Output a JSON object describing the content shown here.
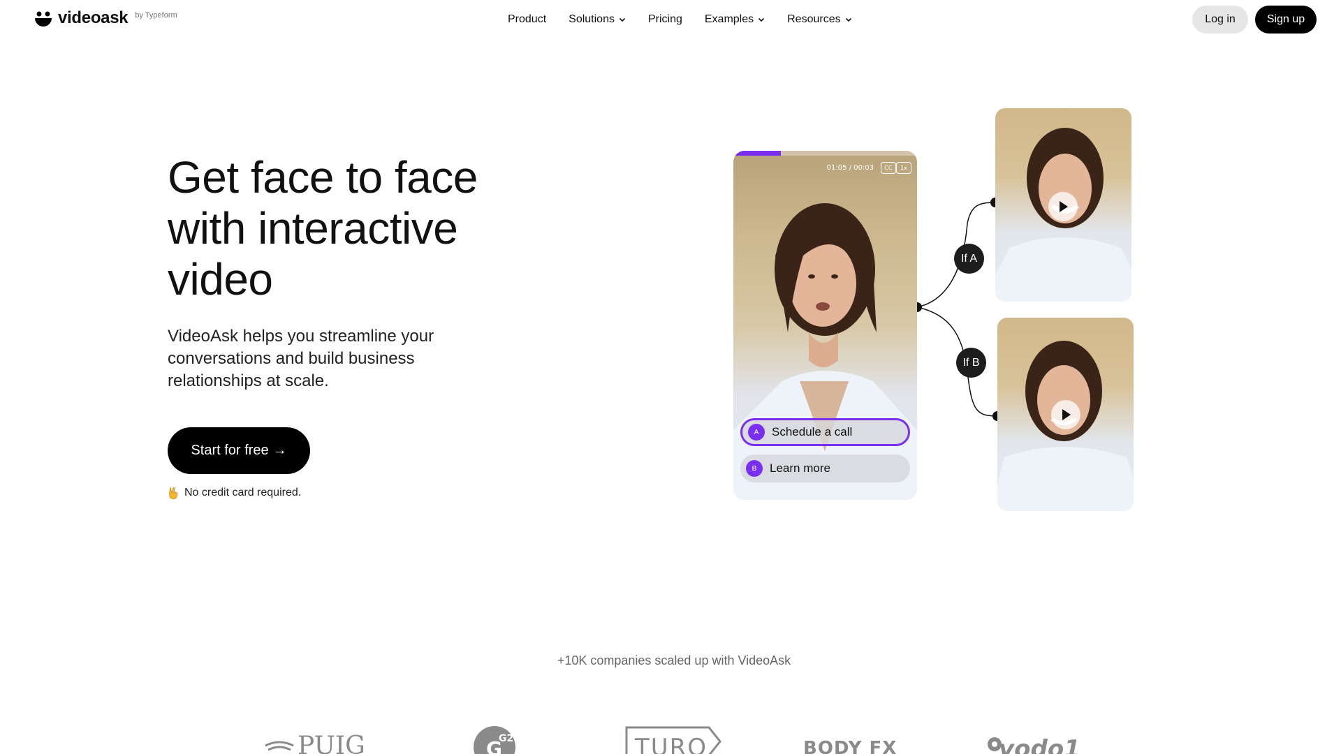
{
  "header": {
    "brand": "videoask",
    "brand_by": "by Typeform",
    "nav": [
      {
        "label": "Product",
        "has_dropdown": false
      },
      {
        "label": "Solutions",
        "has_dropdown": true
      },
      {
        "label": "Pricing",
        "has_dropdown": false
      },
      {
        "label": "Examples",
        "has_dropdown": true
      },
      {
        "label": "Resources",
        "has_dropdown": true
      }
    ],
    "login_label": "Log in",
    "signup_label": "Sign up"
  },
  "hero": {
    "title_lines": [
      "Get face to face",
      "with interactive",
      "video"
    ],
    "subtitle": "VideoAsk helps you streamline your conversations and build business relationships at scale.",
    "cta_label": "Start for free",
    "cta_arrow": "→",
    "note_icon": "victory-hand-icon",
    "note": "No credit card required."
  },
  "video_player": {
    "time_readout": "01:05 / 00:03",
    "cc_label": "CC",
    "speed_label": "1x",
    "progress": 0.26,
    "choices": [
      {
        "letter": "A",
        "label": "Schedule a call"
      },
      {
        "letter": "B",
        "label": "Learn more"
      }
    ],
    "branches": [
      "If A",
      "If B"
    ]
  },
  "social_proof": {
    "tagline": "+10K companies scaled up with VideoAsk",
    "logos": [
      "PUIG",
      "G2",
      "TURO",
      "BODY FX",
      "vodo1"
    ]
  },
  "colors": {
    "accent_purple": "#7a2ff0",
    "black": "#000000",
    "login_bg": "#e6e6e6",
    "muted_text": "#666666"
  }
}
